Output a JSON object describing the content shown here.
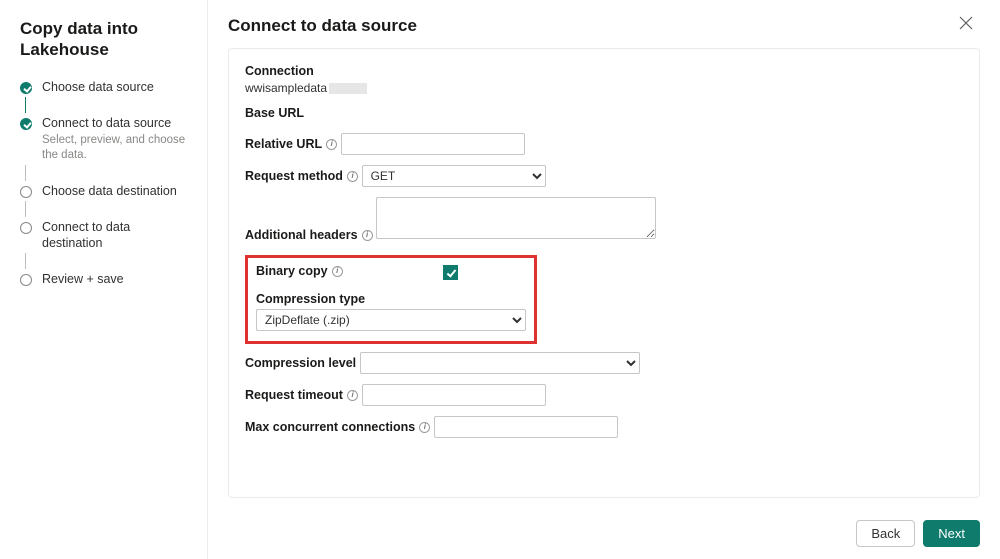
{
  "sidebar": {
    "title": "Copy data into Lakehouse",
    "steps": [
      {
        "label": "Choose data source",
        "state": "done"
      },
      {
        "label": "Connect to data source",
        "sub": "Select, preview, and choose the data.",
        "state": "active"
      },
      {
        "label": "Choose data destination",
        "state": "upcoming"
      },
      {
        "label": "Connect to data destination",
        "state": "upcoming"
      },
      {
        "label": "Review + save",
        "state": "upcoming"
      }
    ]
  },
  "page": {
    "title": "Connect to data source"
  },
  "form": {
    "connection_label": "Connection",
    "connection_value": "wwisampledata",
    "base_url_label": "Base URL",
    "relative_url_label": "Relative URL",
    "relative_url_value": "",
    "request_method_label": "Request method",
    "request_method_value": "GET",
    "additional_headers_label": "Additional headers",
    "additional_headers_value": "",
    "binary_copy_label": "Binary copy",
    "binary_copy_checked": true,
    "compression_type_label": "Compression type",
    "compression_type_value": "ZipDeflate (.zip)",
    "compression_level_label": "Compression level",
    "compression_level_value": "",
    "request_timeout_label": "Request timeout",
    "request_timeout_value": "",
    "max_concurrent_label": "Max concurrent connections",
    "max_concurrent_value": ""
  },
  "footer": {
    "back": "Back",
    "next": "Next"
  }
}
